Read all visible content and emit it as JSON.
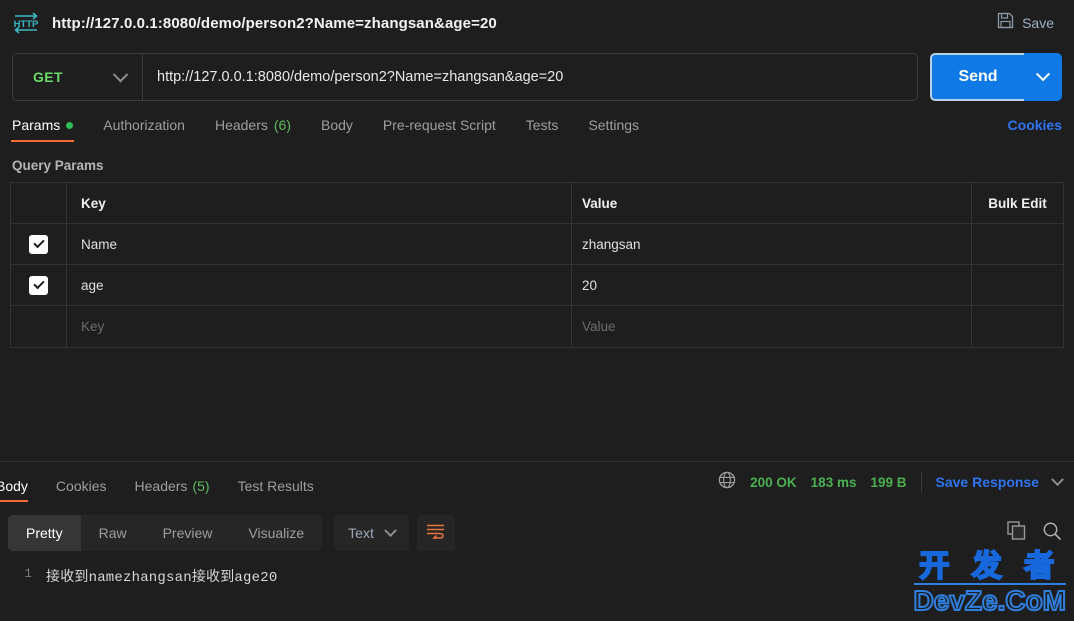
{
  "titlebar": {
    "protocol_icon": "http-icon",
    "request_title": "http://127.0.0.1:8080/demo/person2?Name=zhangsan&age=20",
    "save_label": "Save",
    "save_icon": "floppy-disk-icon"
  },
  "request": {
    "method": "GET",
    "method_caret_icon": "chevron-down-icon",
    "url": "http://127.0.0.1:8080/demo/person2?Name=zhangsan&age=20",
    "send_label": "Send",
    "send_caret_icon": "chevron-down-icon"
  },
  "request_tabs": {
    "items": [
      {
        "label": "Params",
        "badge": "",
        "dot": true,
        "active": true
      },
      {
        "label": "Authorization",
        "badge": "",
        "dot": false,
        "active": false
      },
      {
        "label": "Headers",
        "badge": "(6)",
        "dot": false,
        "active": false
      },
      {
        "label": "Body",
        "badge": "",
        "dot": false,
        "active": false
      },
      {
        "label": "Pre-request Script",
        "badge": "",
        "dot": false,
        "active": false
      },
      {
        "label": "Tests",
        "badge": "",
        "dot": false,
        "active": false
      },
      {
        "label": "Settings",
        "badge": "",
        "dot": false,
        "active": false
      }
    ],
    "cookies_link": "Cookies"
  },
  "query_params": {
    "section_title": "Query Params",
    "columns": {
      "key": "Key",
      "value": "Value",
      "action": "Bulk Edit"
    },
    "rows": [
      {
        "checked": true,
        "key": "Name",
        "value": "zhangsan",
        "placeholder": false
      },
      {
        "checked": true,
        "key": "age",
        "value": "20",
        "placeholder": false
      },
      {
        "checked": false,
        "key": "Key",
        "value": "Value",
        "placeholder": true
      }
    ]
  },
  "response_tabs": {
    "items": [
      {
        "label": "Body",
        "badge": "",
        "active": true
      },
      {
        "label": "Cookies",
        "badge": "",
        "active": false
      },
      {
        "label": "Headers",
        "badge": "(5)",
        "active": false
      },
      {
        "label": "Test Results",
        "badge": "",
        "active": false
      }
    ]
  },
  "response_meta": {
    "network_icon": "globe-icon",
    "status": "200 OK",
    "time": "183 ms",
    "size": "199 B",
    "save_response_label": "Save Response",
    "save_response_caret_icon": "chevron-down-icon"
  },
  "response_toolbar": {
    "view_modes": [
      {
        "label": "Pretty",
        "active": true
      },
      {
        "label": "Raw",
        "active": false
      },
      {
        "label": "Preview",
        "active": false
      },
      {
        "label": "Visualize",
        "active": false
      }
    ],
    "format": "Text",
    "format_caret_icon": "chevron-down-icon",
    "wrap_icon": "word-wrap-icon",
    "copy_icon": "copy-icon",
    "search_icon": "search-icon"
  },
  "response_body": {
    "lines": [
      {
        "number": "1",
        "text": "接收到namezhangsan接收到age20"
      }
    ]
  },
  "watermark": {
    "line1": "开 发 者",
    "line2": "DevZe.CoM"
  },
  "colors": {
    "accent_orange": "#ff6c37",
    "send_blue": "#0f7ae5",
    "link_blue": "#2f74f0",
    "method_green": "#6bd968",
    "status_green": "#4caf50",
    "background": "#1e1e1e",
    "border": "#333333"
  }
}
